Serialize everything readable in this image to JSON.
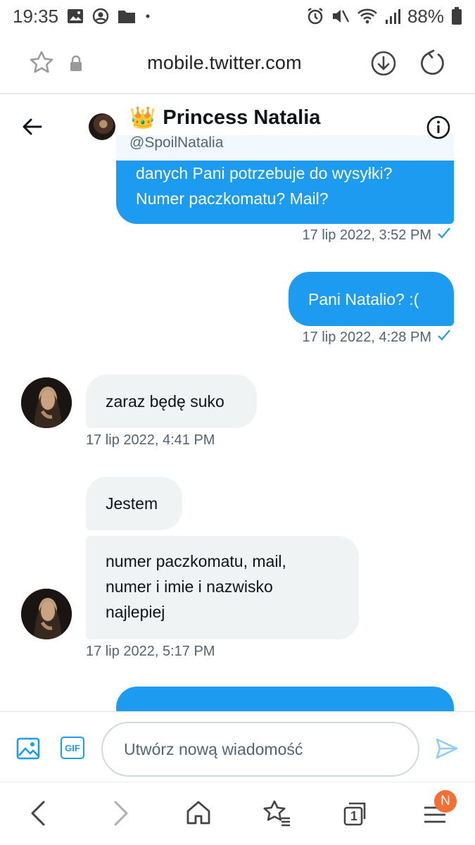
{
  "status_bar": {
    "time": "19:35",
    "battery": "88%",
    "left_icons": [
      "gallery-icon",
      "account-circle-icon",
      "folder-icon",
      "dot-icon"
    ],
    "right_icons": [
      "alarm-icon",
      "mute-icon",
      "wifi-icon",
      "signal-icon",
      "battery-icon"
    ]
  },
  "browser": {
    "url": "mobile.twitter.com"
  },
  "header": {
    "emoji": "👑",
    "name": "Princess Natalia",
    "handle": "@SpoilNatalia"
  },
  "messages": [
    {
      "side": "sent",
      "lines": [
        "danych Pani potrzebuje do wysyłki?",
        "Numer paczkomatu? Mail?"
      ],
      "timestamp": "17 lip 2022, 3:52 PM"
    },
    {
      "side": "sent",
      "lines": [
        "Pani Natalio? :("
      ],
      "timestamp": "17 lip 2022, 4:28 PM"
    },
    {
      "side": "received",
      "lines": [
        "zaraz będę suko"
      ],
      "timestamp": "17 lip 2022, 4:41 PM"
    },
    {
      "side": "received",
      "lines": [
        "Jestem"
      ]
    },
    {
      "side": "received",
      "lines": [
        "numer paczkomatu, mail,",
        "numer i imie i nazwisko",
        "najlepiej"
      ],
      "timestamp": "17 lip 2022, 5:17 PM"
    },
    {
      "side": "sent",
      "lines": [
        ""
      ]
    }
  ],
  "composer": {
    "placeholder": "Utwórz nową wiadomość",
    "gif_label": "GIF"
  },
  "nav": {
    "tabs_count": "1",
    "profile_badge": "N"
  },
  "colors": {
    "accent": "#1d9bf0",
    "received_bubble": "#eff3f4",
    "muted_text": "#536471",
    "badge": "#f56e33"
  }
}
